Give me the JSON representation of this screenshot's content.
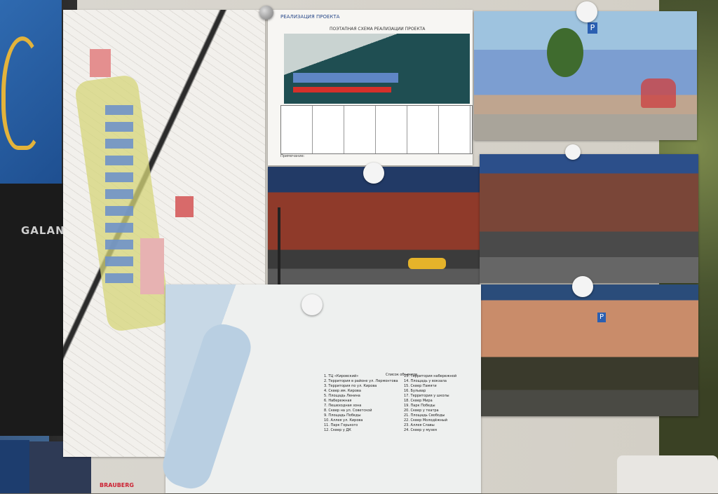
{
  "monitor": {
    "brand": "GALANT"
  },
  "plan": {
    "header": "РЕАЛИЗАЦИЯ ПРОЕКТА",
    "title": "ПОЭТАПНАЯ СХЕМА РЕАЛИЗАЦИИ ПРОЕКТА",
    "note": "Примечание:"
  },
  "photos": {
    "parking_sign": "P"
  },
  "legend": {
    "title": "Список объектов",
    "items": [
      "1. ТЦ «Кировский»",
      "2. Территория в районе ул. Лермонтова",
      "3. Территория по ул. Кирова",
      "4. Сквер им. Кирова",
      "5. Площадь Ленина",
      "6. Набережная",
      "7. Пешеходная зона",
      "8. Сквер на ул. Советской",
      "9. Площадь Победы",
      "10. Аллея ул. Кирова",
      "11. Парк Горького",
      "12. Сквер у ДК",
      "13. Территория набережной",
      "14. Площадь у вокзала",
      "15. Сквер Памяти",
      "16. Бульвар",
      "17. Территория у школы",
      "18. Сквер Мира",
      "19. Парк Победы",
      "20. Сквер у театра",
      "21. Площадь Свободы",
      "22. Сквер Молодёжный",
      "23. Аллея Славы",
      "24. Сквер у музея"
    ]
  },
  "desk": {
    "brand": "BRAUBERG"
  },
  "colors": {
    "road": "#d5d67a",
    "building_blue": "#6f93c8",
    "plan_blue": "#5f86c6",
    "plan_red": "#d6302a",
    "sea": "#1f4e52"
  }
}
